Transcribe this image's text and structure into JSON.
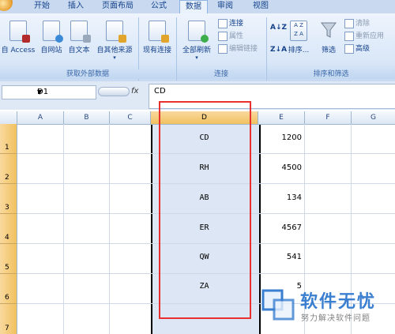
{
  "tabs": [
    {
      "label": "开始",
      "active": false
    },
    {
      "label": "插入",
      "active": false
    },
    {
      "label": "页面布局",
      "active": false
    },
    {
      "label": "公式",
      "active": false
    },
    {
      "label": "数据",
      "active": true
    },
    {
      "label": "审阅",
      "active": false
    },
    {
      "label": "视图",
      "active": false
    }
  ],
  "ribbon": {
    "external": {
      "buttons": [
        "自 Access",
        "自网站",
        "自文本",
        "自其他来源",
        "现有连接"
      ],
      "group_label": "获取外部数据"
    },
    "connections": {
      "refresh_label": "全部刷新",
      "small": [
        "连接",
        "属性",
        "编辑链接"
      ],
      "group_label": "连接"
    },
    "sort_filter": {
      "sort_label": "排序...",
      "filter_label": "筛选",
      "small": [
        "清除",
        "重新应用",
        "高级"
      ],
      "group_label": "排序和筛选"
    }
  },
  "formula_bar": {
    "name_box": "D1",
    "fx": "fx",
    "content": "CD"
  },
  "sheet": {
    "columns": [
      "A",
      "B",
      "C",
      "D",
      "E",
      "F",
      "G"
    ],
    "selected_column": "D",
    "rows": [
      {
        "num": "1",
        "d": "CD",
        "e": "1200"
      },
      {
        "num": "2",
        "d": "RH",
        "e": "4500"
      },
      {
        "num": "3",
        "d": "AB",
        "e": "134"
      },
      {
        "num": "4",
        "d": "ER",
        "e": "4567"
      },
      {
        "num": "5",
        "d": "QW",
        "e": "541"
      },
      {
        "num": "6",
        "d": "ZA",
        "e": "5"
      },
      {
        "num": "7",
        "d": "",
        "e": ""
      }
    ]
  },
  "watermark": {
    "title": "软件无忧",
    "subtitle": "努力解决软件问题"
  },
  "colors": {
    "highlight_box": "#e8312f",
    "selected_header": "#f1c15f",
    "ribbon_bg": "#d9e7f8"
  }
}
